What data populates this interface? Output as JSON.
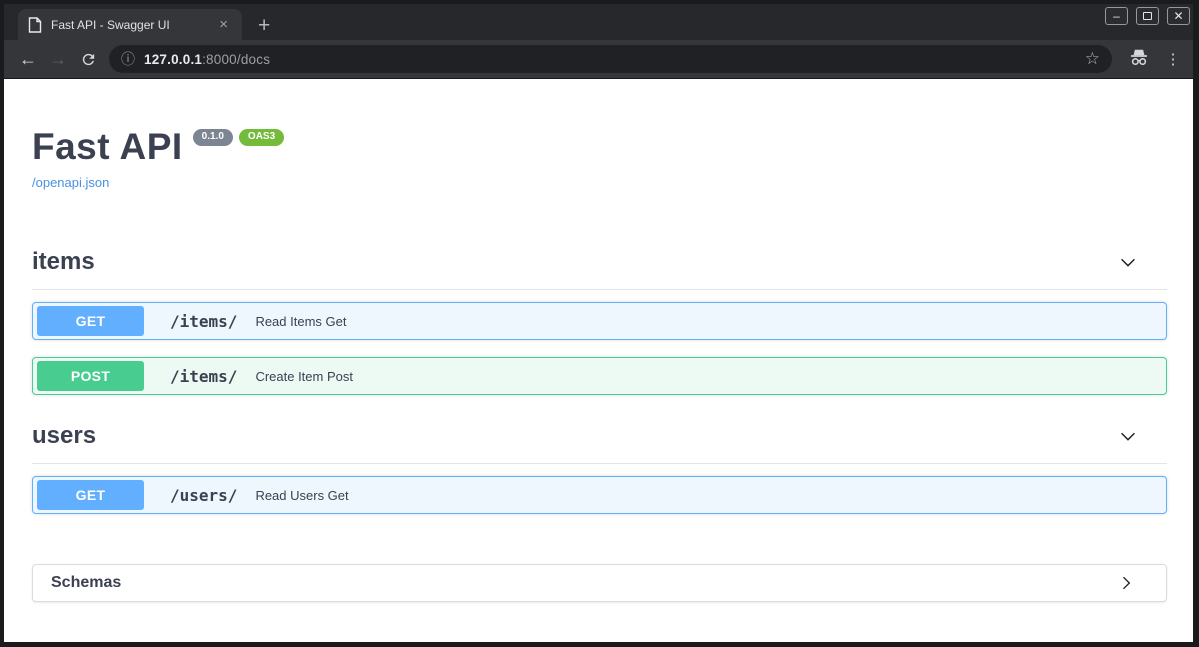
{
  "window": {
    "tab": {
      "title": "Fast API - Swagger UI"
    },
    "url": {
      "host": "127.0.0.1",
      "rest": ":8000/docs"
    }
  },
  "icons": {
    "tab_close": "×",
    "new_tab": "+",
    "back": "←",
    "forward": "→",
    "info": "ⓘ",
    "star": "☆",
    "menu": "⋮",
    "minimize": "–",
    "close_window": "✕"
  },
  "page": {
    "title": "Fast API",
    "version_badge": "0.1.0",
    "oas_badge": "OAS3",
    "spec_link": "/openapi.json",
    "sections": [
      {
        "name": "items",
        "operations": [
          {
            "method": "GET",
            "path": "/items/",
            "summary": "Read Items Get"
          },
          {
            "method": "POST",
            "path": "/items/",
            "summary": "Create Item Post"
          }
        ]
      },
      {
        "name": "users",
        "operations": [
          {
            "method": "GET",
            "path": "/users/",
            "summary": "Read Users Get"
          }
        ]
      }
    ],
    "schemas_label": "Schemas"
  },
  "colors": {
    "get": "#61affe",
    "get_bg": "#eef6fe",
    "post": "#49cc90",
    "post_bg": "#ecfaf3",
    "version_badge_bg": "#7d8492",
    "oas_badge_bg": "#74bb3b",
    "link": "#4990e2",
    "heading": "#3b4151"
  }
}
